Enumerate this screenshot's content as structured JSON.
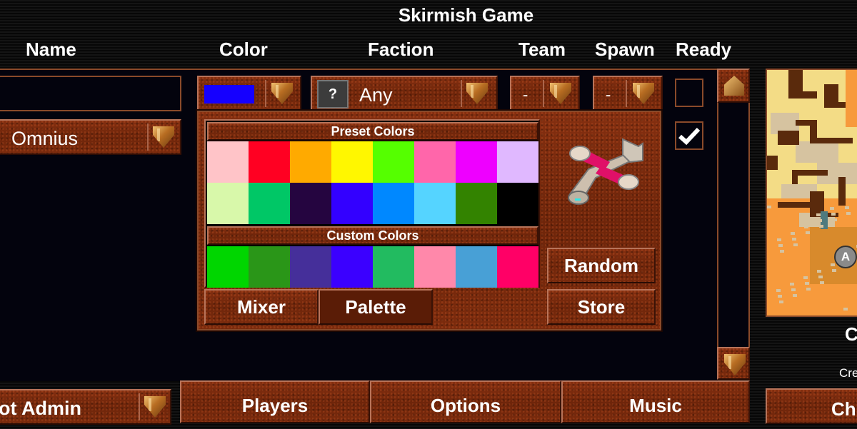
{
  "title": "Skirmish Game",
  "headers": {
    "name": "Name",
    "color": "Color",
    "faction": "Faction",
    "team": "Team",
    "spawn": "Spawn",
    "ready": "Ready"
  },
  "players": [
    {
      "name": "",
      "color": "#1500ff",
      "faction_icon": "?",
      "faction": "Any",
      "team": "-",
      "spawn": "-",
      "ready": false
    },
    {
      "name": "Omnius",
      "ready": true
    }
  ],
  "color_popup": {
    "preset_title": "Preset Colors",
    "preset_colors": [
      "#ffc4c8",
      "#ff0022",
      "#ffaa00",
      "#fff700",
      "#55ff00",
      "#ff66aa",
      "#ee00ff",
      "#e0b8ff",
      "#d8f8aa",
      "#00c766",
      "#250540",
      "#3300ff",
      "#0088ff",
      "#55d4ff",
      "#338300",
      "#000000"
    ],
    "custom_title": "Custom Colors",
    "custom_colors": [
      "#00d600",
      "#2a9618",
      "#452f9a",
      "#3b00ff",
      "#22bb60",
      "#ff88aa",
      "#48a0d6",
      "#ff0066"
    ],
    "mixer_label": "Mixer",
    "palette_label": "Palette",
    "random_label": "Random",
    "store_label": "Store",
    "preview": "aircraft-unit-preview"
  },
  "bottom": {
    "admin_label": "ot Admin",
    "tabs": [
      "Players",
      "Options",
      "Music"
    ],
    "right_button": "Ch"
  },
  "map": {
    "label_partial": "C",
    "subtitle_partial": "Cre",
    "spawn_marker": "A"
  }
}
